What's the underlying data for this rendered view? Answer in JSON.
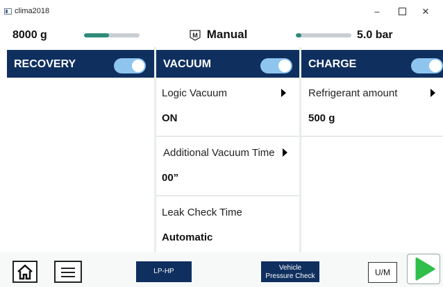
{
  "window": {
    "title": "clima2018",
    "minimize": "–",
    "close": "✕"
  },
  "status": {
    "weight": "8000 g",
    "weight_level_percent": 45,
    "mode": "Manual",
    "mode_icon": "manifold-m-icon",
    "pressure": "5.0 bar",
    "pressure_level_percent": 10,
    "accent_color": "#2e8b7a"
  },
  "panels": {
    "recovery": {
      "title": "RECOVERY",
      "enabled": true
    },
    "vacuum": {
      "title": "VACUUM",
      "enabled": true,
      "items": [
        {
          "label": "Logic Vacuum",
          "value": "ON"
        },
        {
          "label": "Additional Vacuum Time",
          "value": "00”"
        },
        {
          "label": "Leak Check Time",
          "value": "Automatic"
        }
      ]
    },
    "charge": {
      "title": "CHARGE",
      "enabled": true,
      "items": [
        {
          "label": "Refrigerant amount",
          "value": "500 g"
        }
      ]
    }
  },
  "bottom": {
    "lp_hp": "LP-HP",
    "vehicle_pressure_check_line1": "Vehicle",
    "vehicle_pressure_check_line2": "Pressure Check",
    "um": "U/M"
  },
  "colors": {
    "header_navy": "#0f2f5f",
    "toggle_on": "#8ec5ef",
    "play_green": "#2fbf4a"
  }
}
